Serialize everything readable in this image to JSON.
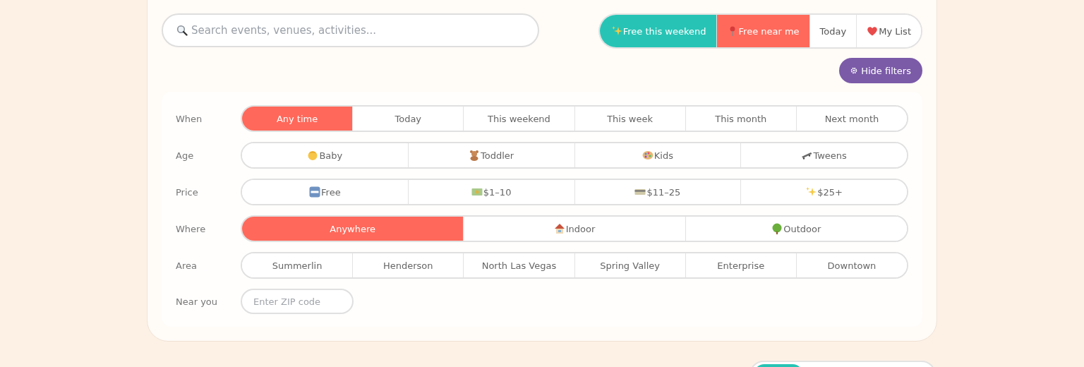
{
  "search": {
    "placeholder": "Search events, venues, activities..."
  },
  "quick_filters": [
    {
      "label": "Free this weekend",
      "color": "#27c4b5"
    },
    {
      "label": "Free near me",
      "color": "#ff695b"
    },
    {
      "label": "Today",
      "color": "#ffffff"
    },
    {
      "label": "My List",
      "color": "#ffffff"
    }
  ],
  "hide_filters_button": "Hide filters",
  "filters": [
    {
      "label": "When",
      "options": [
        {
          "text": "Any time",
          "selected": true
        },
        {
          "text": "Today",
          "selected": false
        },
        {
          "text": "This weekend",
          "selected": false
        },
        {
          "text": "This week",
          "selected": false
        },
        {
          "text": "This month",
          "selected": false
        },
        {
          "text": "Next month",
          "selected": false
        }
      ]
    },
    {
      "label": "Age",
      "options": [
        {
          "text": "Baby",
          "selected": false
        },
        {
          "text": "Toddler",
          "selected": false
        },
        {
          "text": "Kids",
          "selected": false
        },
        {
          "text": "Tweens",
          "selected": false
        }
      ]
    },
    {
      "label": "Price",
      "options": [
        {
          "text": "Free",
          "selected": false
        },
        {
          "text": "$1–10",
          "selected": false
        },
        {
          "text": "$11–25",
          "selected": false
        },
        {
          "text": "$25+",
          "selected": false
        }
      ]
    },
    {
      "label": "Where",
      "options": [
        {
          "text": "Anywhere",
          "selected": true
        },
        {
          "text": "Indoor",
          "selected": false
        },
        {
          "text": "Outdoor",
          "selected": false
        }
      ]
    },
    {
      "label": "Area",
      "options": [
        {
          "text": "Summerlin",
          "selected": false
        },
        {
          "text": "Henderson",
          "selected": false
        },
        {
          "text": "North Las Vegas",
          "selected": false
        },
        {
          "text": "Spring Valley",
          "selected": false
        },
        {
          "text": "Enterprise",
          "selected": false
        },
        {
          "text": "Downtown",
          "selected": false
        }
      ]
    }
  ],
  "near_you": {
    "label": "Near you",
    "placeholder": "Enter ZIP code"
  },
  "view_toggle": {
    "segments": [
      {
        "selected": true
      }
    ]
  }
}
